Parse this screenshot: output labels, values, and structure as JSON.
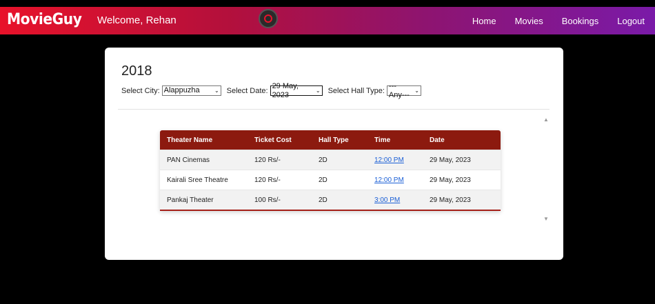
{
  "navbar": {
    "brand": "MovieGuy",
    "welcome": "Welcome, Rehan",
    "links": [
      "Home",
      "Movies",
      "Bookings",
      "Logout"
    ]
  },
  "movie": {
    "title": "2018"
  },
  "filters": {
    "city_label": "Select City:",
    "city_value": "Alappuzha",
    "date_label": "Select Date:",
    "date_value": "29 May, 2023",
    "hall_label": "Select Hall Type:",
    "hall_value": "---Any---"
  },
  "table": {
    "headers": [
      "Theater Name",
      "Ticket Cost",
      "Hall Type",
      "Time",
      "Date"
    ],
    "rows": [
      [
        "PAN Cinemas",
        "120 Rs/-",
        "2D",
        "12:00 PM",
        "29 May, 2023"
      ],
      [
        "Kairali Sree Theatre",
        "120 Rs/-",
        "2D",
        "12:00 PM",
        "29 May, 2023"
      ],
      [
        "Pankaj Theater",
        "100 Rs/-",
        "2D",
        "3:00 PM",
        "29 May, 2023"
      ]
    ]
  },
  "colors": {
    "nav_gradient_start": "#e8122a",
    "nav_gradient_end": "#7a1aa8",
    "table_header": "#8c1a0f",
    "link": "#1a5fd6"
  }
}
